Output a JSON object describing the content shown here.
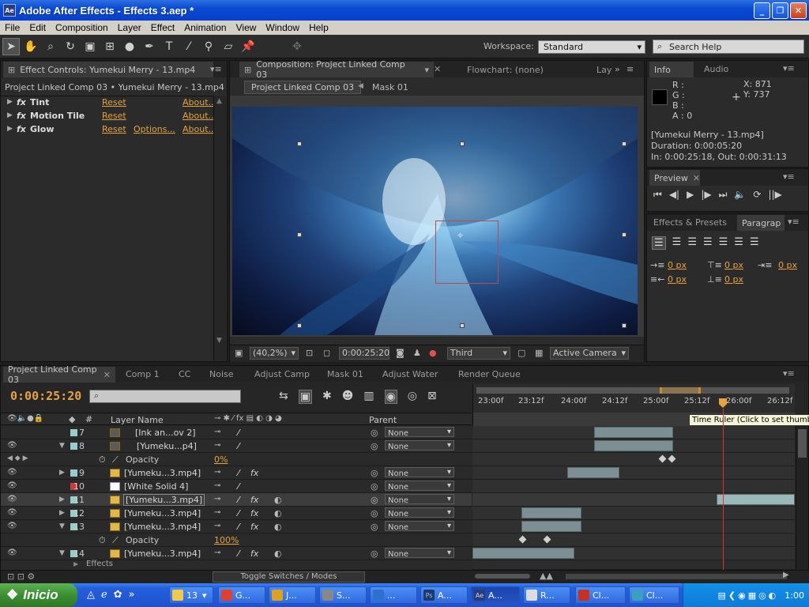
{
  "window": {
    "title": "Adobe After Effects - Effects 3.aep *",
    "app_icon": "Ae"
  },
  "menu": [
    "File",
    "Edit",
    "Composition",
    "Layer",
    "Effect",
    "Animation",
    "View",
    "Window",
    "Help"
  ],
  "toolbar": {
    "workspace_label": "Workspace:",
    "workspace_value": "Standard",
    "search_placeholder": "Search Help"
  },
  "effect_controls": {
    "tab": "Effect Controls: Yumekui Merry - 13.mp4",
    "subtitle": "Project Linked Comp 03 • Yumekui Merry - 13.mp4",
    "effects": [
      {
        "name": "Tint",
        "reset": "Reset",
        "options": "",
        "about": "About..."
      },
      {
        "name": "Motion Tile",
        "reset": "Reset",
        "options": "",
        "about": "About..."
      },
      {
        "name": "Glow",
        "reset": "Reset",
        "options": "Options...",
        "about": "About..."
      }
    ],
    "fx_label": "fx"
  },
  "composition": {
    "tab": "Composition: Project Linked Comp 03",
    "flowchart_tab": "Flowchart: (none)",
    "layer_tab": "Lay",
    "breadcrumb_comp": "Project Linked Comp 03",
    "breadcrumb_mask": "Mask 01",
    "zoom": "(40,2%)",
    "timecode": "0:00:25:20",
    "resolution": "Third",
    "camera": "Active Camera"
  },
  "info": {
    "tabs": [
      "Info",
      "Audio"
    ],
    "r": "R :",
    "g": "G :",
    "b": "B :",
    "a": "A : 0",
    "x": "X: 871",
    "y": "Y: 737",
    "clip_name": "[Yumekui Merry - 13.mp4]",
    "duration": "Duration: 0:00:05:20",
    "inout": "In: 0:00:25:18, Out: 0:00:31:13"
  },
  "preview": {
    "tab": "Preview"
  },
  "effects_presets": {
    "tabs": [
      "Effects & Presets",
      "Paragrap"
    ],
    "indents": [
      "0 px",
      "0 px",
      "0 px",
      "0 px",
      "0 px"
    ]
  },
  "timeline": {
    "tabs": [
      "Project Linked Comp 03",
      "Comp 1",
      "CC",
      "Noise",
      "Adjust Camp",
      "Mask 01",
      "Adjust Water",
      "Render Queue"
    ],
    "timecode": "0:00:25:20",
    "col_number": "#",
    "col_layer_name": "Layer Name",
    "col_parent": "Parent",
    "ruler_labels": [
      "23:00f",
      "23:12f",
      "24:00f",
      "24:12f",
      "25:00f",
      "25:12f",
      "26:00f",
      "26:12f"
    ],
    "tooltip": "Time Ruler (Click to set thumb)",
    "toggle_label": "Toggle Switches / Modes",
    "effects_row": "Effects",
    "layers": [
      {
        "num": "7",
        "name": "[Ink an...ov 2]"
      },
      {
        "num": "8",
        "name": "[Yumeku...p4]"
      },
      {
        "num": "9",
        "name": "[Yumeku...3.mp4]"
      },
      {
        "num": "10",
        "name": "[White Solid 4]"
      },
      {
        "num": "11",
        "name": "[Yumeku...3.mp4]"
      },
      {
        "num": "12",
        "name": "[Yumeku...3.mp4]"
      },
      {
        "num": "13",
        "name": "[Yumeku...3.mp4]"
      },
      {
        "num": "14",
        "name": "[Yumeku...3.mp4]"
      }
    ],
    "opacity_label": "Opacity",
    "opacity_8": "0%",
    "opacity_13": "100%",
    "parent_none": "None"
  },
  "taskbar": {
    "start": "Inicio",
    "folder_count": "13",
    "items": [
      "G...",
      "J...",
      "S...",
      "...",
      "A...",
      "A...",
      "R...",
      "Cl...",
      "Cl..."
    ],
    "clock": "1:00"
  }
}
